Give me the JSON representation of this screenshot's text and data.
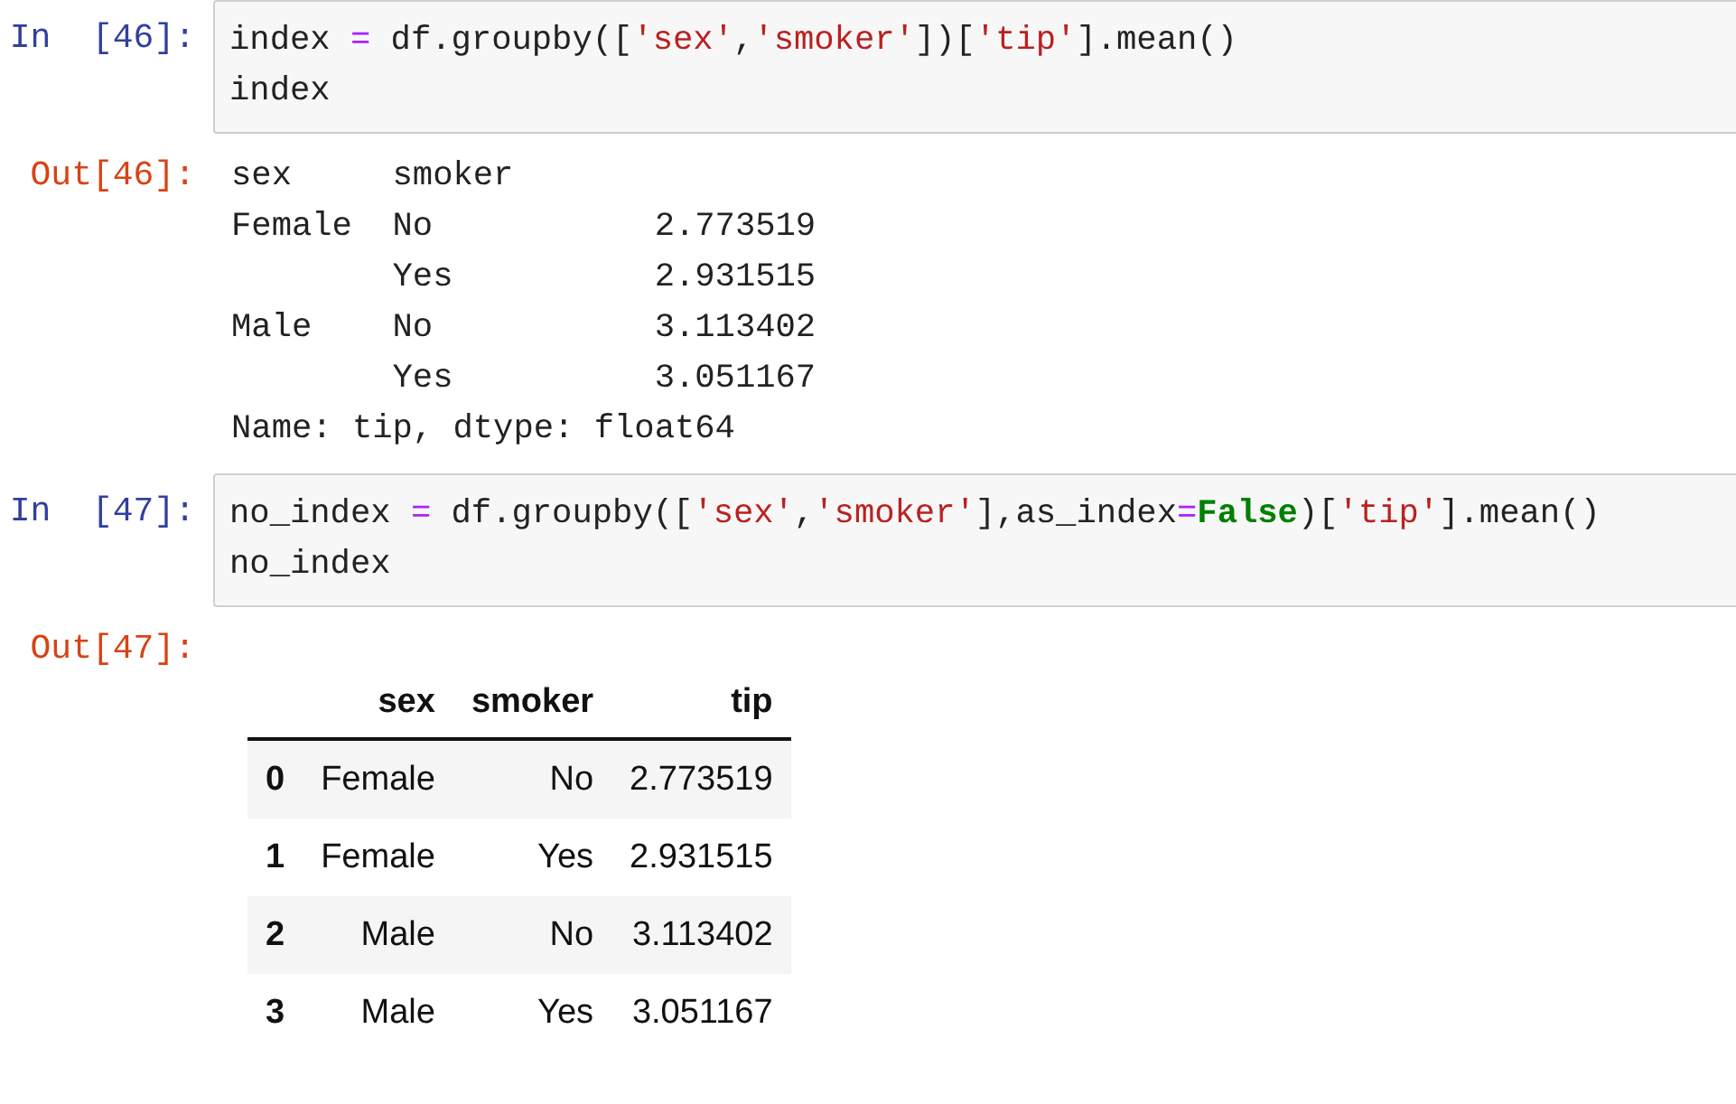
{
  "cells": [
    {
      "input_prompt": "In  [46]:",
      "code": [
        [
          {
            "kind": "plain",
            "text": "index "
          },
          {
            "kind": "op",
            "text": "="
          },
          {
            "kind": "plain",
            "text": " df.groupby(["
          },
          {
            "kind": "str",
            "text": "'sex'"
          },
          {
            "kind": "plain",
            "text": ","
          },
          {
            "kind": "str",
            "text": "'smoker'"
          },
          {
            "kind": "plain",
            "text": "])["
          },
          {
            "kind": "str",
            "text": "'tip'"
          },
          {
            "kind": "plain",
            "text": "].mean()"
          }
        ],
        [
          {
            "kind": "plain",
            "text": "index"
          }
        ]
      ],
      "output_prompt": "Out[46]:",
      "output": {
        "kind": "text",
        "lines": [
          "sex     smoker",
          "Female  No           2.773519",
          "        Yes          2.931515",
          "Male    No           3.113402",
          "        Yes          3.051167",
          "Name: tip, dtype: float64"
        ]
      }
    },
    {
      "input_prompt": "In  [47]:",
      "code": [
        [
          {
            "kind": "plain",
            "text": "no_index "
          },
          {
            "kind": "op",
            "text": "="
          },
          {
            "kind": "plain",
            "text": " df.groupby(["
          },
          {
            "kind": "str",
            "text": "'sex'"
          },
          {
            "kind": "plain",
            "text": ","
          },
          {
            "kind": "str",
            "text": "'smoker'"
          },
          {
            "kind": "plain",
            "text": "],as_index"
          },
          {
            "kind": "op",
            "text": "="
          },
          {
            "kind": "kw",
            "text": "False"
          },
          {
            "kind": "plain",
            "text": ")["
          },
          {
            "kind": "str",
            "text": "'tip'"
          },
          {
            "kind": "plain",
            "text": "].mean()"
          }
        ],
        [
          {
            "kind": "plain",
            "text": "no_index"
          }
        ]
      ],
      "output_prompt": "Out[47]:",
      "output": {
        "kind": "table",
        "columns": [
          "sex",
          "smoker",
          "tip"
        ],
        "rows": [
          {
            "index": "0",
            "cells": [
              "Female",
              "No",
              "2.773519"
            ]
          },
          {
            "index": "1",
            "cells": [
              "Female",
              "Yes",
              "2.931515"
            ]
          },
          {
            "index": "2",
            "cells": [
              "Male",
              "No",
              "3.113402"
            ]
          },
          {
            "index": "3",
            "cells": [
              "Male",
              "Yes",
              "3.051167"
            ]
          }
        ]
      }
    }
  ]
}
